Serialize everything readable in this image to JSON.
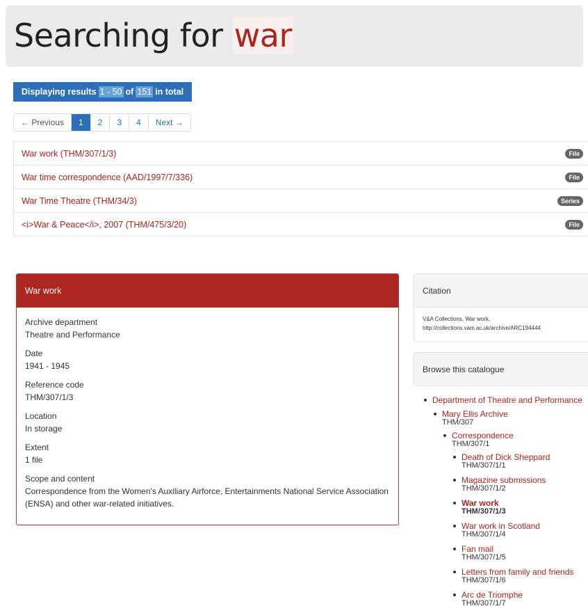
{
  "header": {
    "prefix": "Searching for",
    "term": "war"
  },
  "results_bar": {
    "label": "Displaying results",
    "range": "1 - 50",
    "of": "of",
    "total": "151",
    "suffix": "in total"
  },
  "pagination": {
    "prev": "← Previous",
    "pages": [
      "1",
      "2",
      "3",
      "4"
    ],
    "active": "1",
    "next": "Next →"
  },
  "results": [
    {
      "title": "War work (THM/307/1/3)",
      "badge": "File"
    },
    {
      "title": "War time correspondence (AAD/1997/7/336)",
      "badge": "File"
    },
    {
      "title": "War Time Theatre (THM/34/3)",
      "badge": "Series"
    },
    {
      "title": "<i>War & Peace</i>, 2007 (THM/475/3/20)",
      "badge": "File"
    }
  ],
  "detail": {
    "title": "War work",
    "fields": [
      {
        "label": "Archive department",
        "value": "Theatre and Performance"
      },
      {
        "label": "Date",
        "value": "1941 - 1945"
      },
      {
        "label": "Reference code",
        "value": "THM/307/1/3"
      },
      {
        "label": "Location",
        "value": "In storage"
      },
      {
        "label": "Extent",
        "value": "1 file"
      },
      {
        "label": "Scope and content",
        "value": "Correspondence from the Women's Auxiliary Airforce, Entertainments National Service Association (ENSA) and other war-related initiatives."
      }
    ]
  },
  "citation": {
    "title": "Citation",
    "line1": "V&A Collections, War work,",
    "line2": "http://collections.vam.ac.uk/archive/ARC194444"
  },
  "browse": {
    "title": "Browse this catalogue",
    "root": "Department of Theatre and Performance",
    "archive": {
      "label": "Mary Ellis Archive",
      "code": "THM/307"
    },
    "series": {
      "label": "Correspondence",
      "code": "THM/307/1"
    },
    "items": [
      {
        "label": "Death of Dick Sheppard",
        "code": "THM/307/1/1"
      },
      {
        "label": "Magazine submissions",
        "code": "THM/307/1/2"
      },
      {
        "label": "War work",
        "code": "THM/307/1/3"
      },
      {
        "label": "War work in Scotland",
        "code": "THM/307/1/4"
      },
      {
        "label": "Fan mail",
        "code": "THM/307/1/5"
      },
      {
        "label": "Letters from family and friends",
        "code": "THM/307/1/6"
      },
      {
        "label": "Arc de Triomphe",
        "code": "THM/307/1/7"
      }
    ]
  },
  "colors": {
    "accent_red": "#ad2621",
    "link_red": "#a8261f",
    "accent_blue": "#2c6fb6"
  }
}
